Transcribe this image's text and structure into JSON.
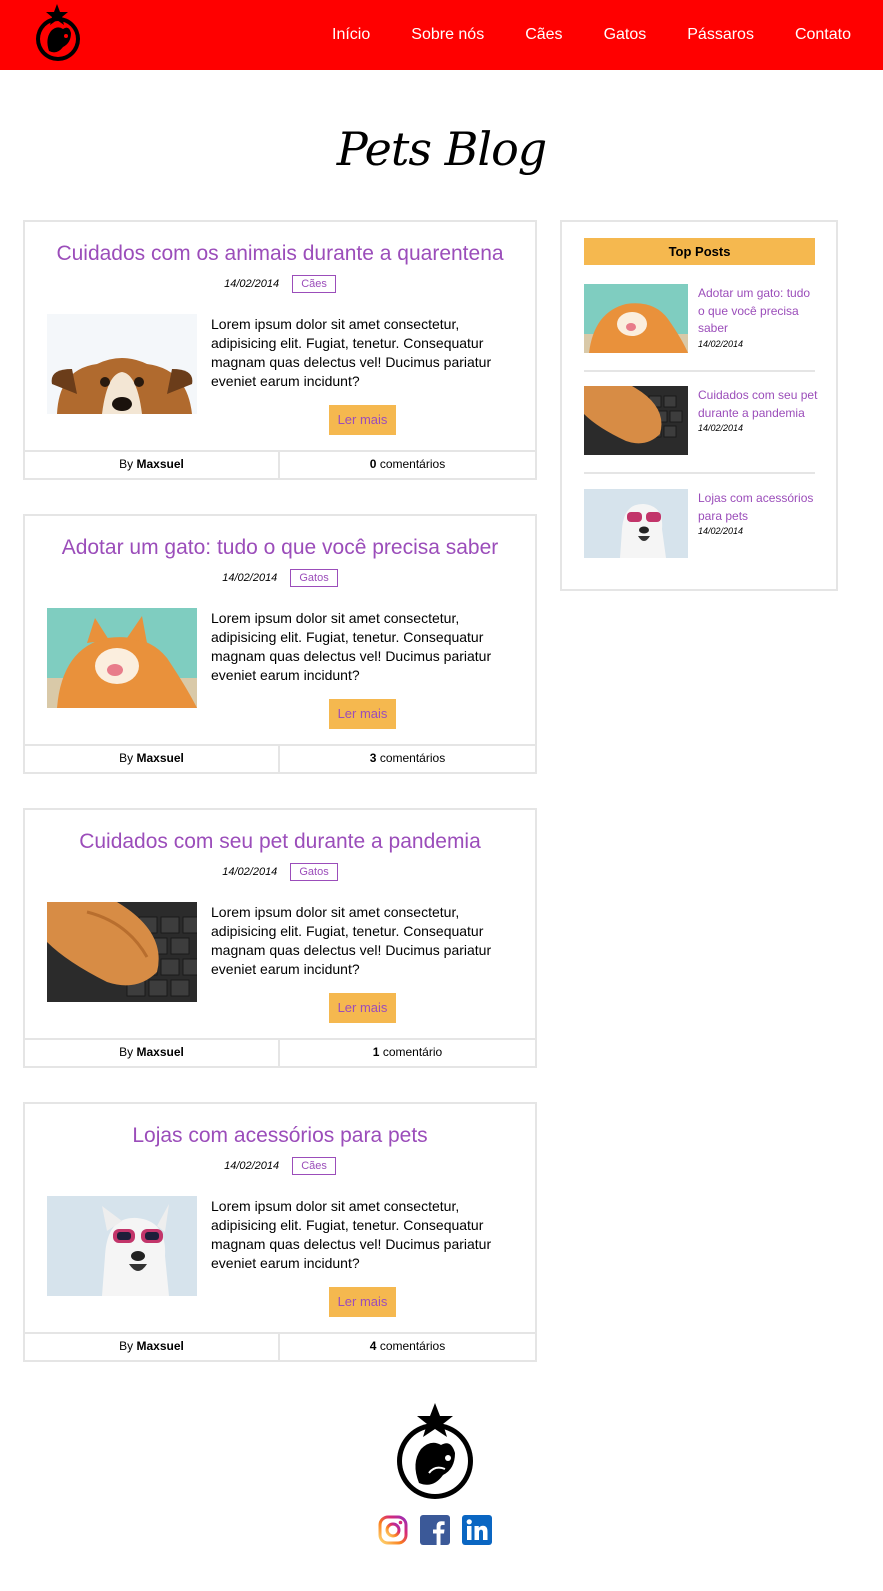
{
  "nav": {
    "items": [
      "Início",
      "Sobre nós",
      "Cães",
      "Gatos",
      "Pássaros",
      "Contato"
    ]
  },
  "blog_title": "Pets Blog",
  "posts": [
    {
      "title": "Cuidados com os animais durante a quarentena",
      "date": "14/02/2014",
      "tag": "Cães",
      "excerpt": "Lorem ipsum dolor sit amet consectetur, adipisicing elit. Fugiat, tenetur. Consequatur magnam quas delectus vel! Ducimus pariatur eveniet earum incidunt?",
      "button": "Ler mais",
      "by": "By",
      "author": "Maxsuel",
      "comment_count": "0",
      "comment_label": "comentários"
    },
    {
      "title": "Adotar um gato: tudo o que você precisa saber",
      "date": "14/02/2014",
      "tag": "Gatos",
      "excerpt": "Lorem ipsum dolor sit amet consectetur, adipisicing elit. Fugiat, tenetur. Consequatur magnam quas delectus vel! Ducimus pariatur eveniet earum incidunt?",
      "button": "Ler mais",
      "by": "By",
      "author": "Maxsuel",
      "comment_count": "3",
      "comment_label": "comentários"
    },
    {
      "title": "Cuidados com seu pet durante a pandemia",
      "date": "14/02/2014",
      "tag": "Gatos",
      "excerpt": "Lorem ipsum dolor sit amet consectetur, adipisicing elit. Fugiat, tenetur. Consequatur magnam quas delectus vel! Ducimus pariatur eveniet earum incidunt?",
      "button": "Ler mais",
      "by": "By",
      "author": "Maxsuel",
      "comment_count": "1",
      "comment_label": "comentário"
    },
    {
      "title": "Lojas com acessórios para pets",
      "date": "14/02/2014",
      "tag": "Cães",
      "excerpt": "Lorem ipsum dolor sit amet consectetur, adipisicing elit. Fugiat, tenetur. Consequatur magnam quas delectus vel! Ducimus pariatur eveniet earum incidunt?",
      "button": "Ler mais",
      "by": "By",
      "author": "Maxsuel",
      "comment_count": "4",
      "comment_label": "comentários"
    }
  ],
  "sidebar": {
    "heading": "Top Posts",
    "items": [
      {
        "title": "Adotar um gato: tudo o que você precisa saber",
        "date": "14/02/2014"
      },
      {
        "title": "Cuidados com seu pet durante a pandemia",
        "date": "14/02/2014"
      },
      {
        "title": "Lojas com acessórios para pets",
        "date": "14/02/2014"
      }
    ]
  },
  "colors": {
    "nav_bg": "#ff0000",
    "accent": "#9b4dba",
    "button_bg": "#f5b84f"
  },
  "icons": [
    "pets-logo-icon",
    "instagram-icon",
    "facebook-icon",
    "linkedin-icon"
  ]
}
